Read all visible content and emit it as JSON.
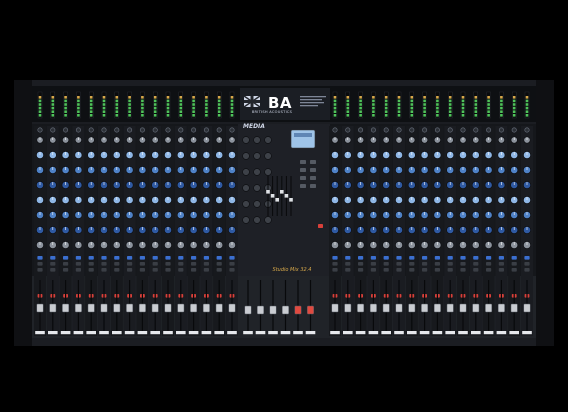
{
  "device": {
    "brand_logo": "BA",
    "brand_sub": "BRITISH ACOUSTICS",
    "model": "Studio Mix 32.4",
    "media_label": "MEDIA",
    "left_channels": 16,
    "right_channels": 16,
    "colors": {
      "body": "#23262c",
      "panel": "#15171b",
      "strip_dark": "#1f2227",
      "knob_blue_light": "#8fb7e6",
      "knob_blue_mid": "#4f82c7",
      "knob_blue_dark": "#2f5aa3",
      "knob_gray": "#8c939d",
      "led_green": "#4fc35a",
      "mute_red": "#d8403a",
      "select_blue": "#3b6fd0",
      "fader_cap": "#c9ccd1"
    }
  }
}
